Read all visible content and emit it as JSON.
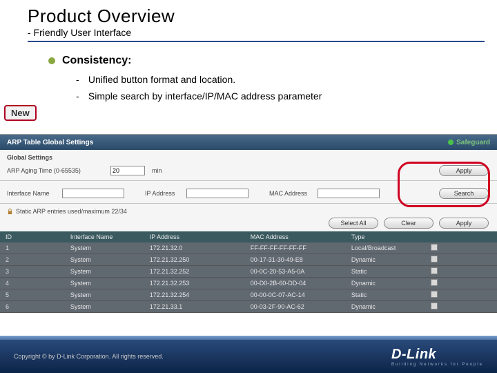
{
  "slide": {
    "title": "Product Overview",
    "subtitle": "- Friendly User Interface",
    "bullet1": "Consistency:",
    "sub1": "Unified button format and location.",
    "sub2": "Simple search by interface/IP/MAC address parameter",
    "new_badge": "New"
  },
  "app": {
    "panel_title": "ARP Table Global Settings",
    "safeguard": "Safeguard",
    "global_settings_label": "Global Settings",
    "aging_label": "ARP Aging Time (0-65535)",
    "aging_value": "20",
    "aging_unit": "min",
    "if_label": "Interface Name",
    "ip_label": "IP Address",
    "mac_label": "MAC Address",
    "entries_text": "Static ARP entries used/maximum 22/34",
    "buttons": {
      "apply": "Apply",
      "search": "Search",
      "select_all": "Select All",
      "clear": "Clear",
      "apply2": "Apply"
    },
    "columns": {
      "id": "ID",
      "iface": "Interface Name",
      "ip": "IP Address",
      "mac": "MAC Address",
      "type": "Type",
      "sel": ""
    },
    "rows": [
      {
        "id": "1",
        "iface": "System",
        "ip": "172.21.32.0",
        "mac": "FF-FF-FF-FF-FF-FF",
        "type": "Local/Broadcast"
      },
      {
        "id": "2",
        "iface": "System",
        "ip": "172.21.32.250",
        "mac": "00-17-31-30-49-E8",
        "type": "Dynamic"
      },
      {
        "id": "3",
        "iface": "System",
        "ip": "172.21.32.252",
        "mac": "00-0C-20-53-A5-0A",
        "type": "Static"
      },
      {
        "id": "4",
        "iface": "System",
        "ip": "172.21.32.253",
        "mac": "00-D0-2B-60-DD-04",
        "type": "Dynamic"
      },
      {
        "id": "5",
        "iface": "System",
        "ip": "172.21.32.254",
        "mac": "00-00-0C-07-AC-14",
        "type": "Static"
      },
      {
        "id": "6",
        "iface": "System",
        "ip": "172.21.33.1",
        "mac": "00-03-2F-90-AC-62",
        "type": "Dynamic"
      }
    ]
  },
  "footer": {
    "copyright": "Copyright © by D-Link Corporation. All rights reserved.",
    "brand": "D-Link",
    "brand_sub": "Building Networks for People"
  }
}
